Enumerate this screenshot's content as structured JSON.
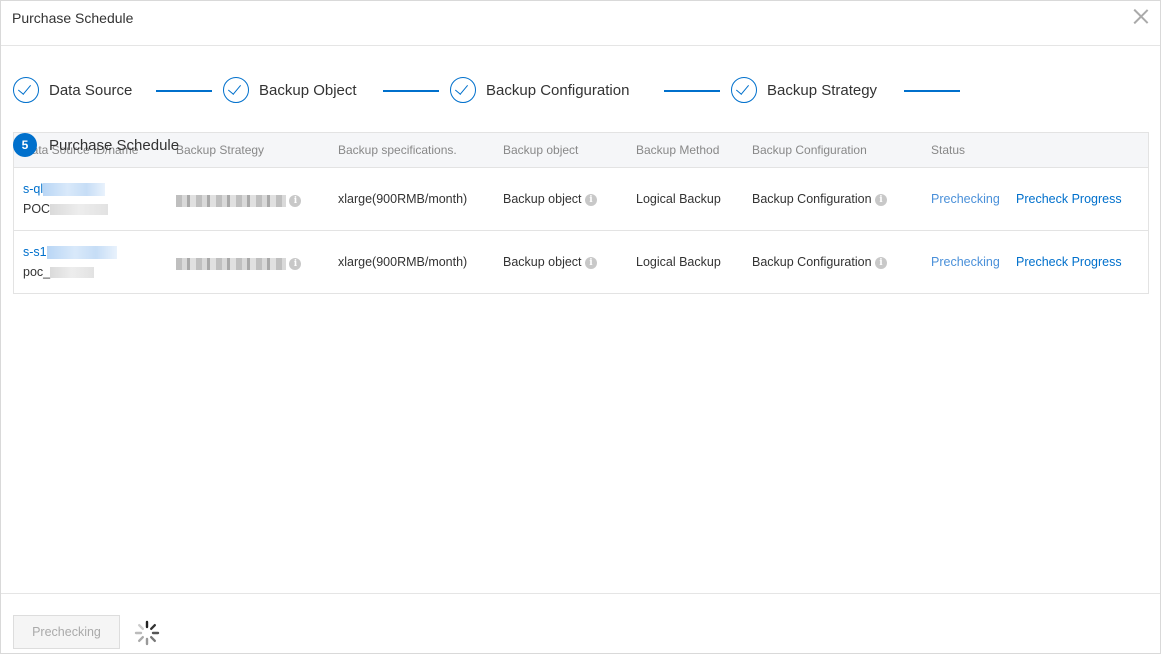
{
  "dialog": {
    "title": "Purchase Schedule"
  },
  "steps": [
    {
      "label": "Data Source",
      "state": "done"
    },
    {
      "label": "Backup Object",
      "state": "done"
    },
    {
      "label": "Backup Configuration",
      "state": "done"
    },
    {
      "label": "Backup Strategy",
      "state": "done"
    },
    {
      "label": "Purchase Schedule",
      "state": "active",
      "number": "5"
    }
  ],
  "table": {
    "headers": [
      "Data Source ID/name",
      "Backup Strategy",
      "Backup specifications.",
      "Backup object",
      "Backup Method",
      "Backup Configuration",
      "Status"
    ],
    "rows": [
      {
        "source_id": "s-ql",
        "source_name": "POC",
        "spec": "xlarge(900RMB/month)",
        "backup_object": "Backup object",
        "method": "Logical Backup",
        "configuration": "Backup Configuration",
        "status": "Prechecking",
        "action": "Precheck Progress"
      },
      {
        "source_id": "s-s1",
        "source_name": "poc_",
        "spec": "xlarge(900RMB/month)",
        "backup_object": "Backup object",
        "method": "Logical Backup",
        "configuration": "Backup Configuration",
        "status": "Prechecking",
        "action": "Precheck Progress"
      }
    ]
  },
  "footer": {
    "button_label": "Prechecking"
  },
  "icons": {
    "close": "close-icon",
    "check": "check-circle-icon",
    "info": "info-icon",
    "spinner": "loading-spinner-icon"
  },
  "colors": {
    "accent": "#0070cc",
    "status_link": "#4a90d9"
  }
}
